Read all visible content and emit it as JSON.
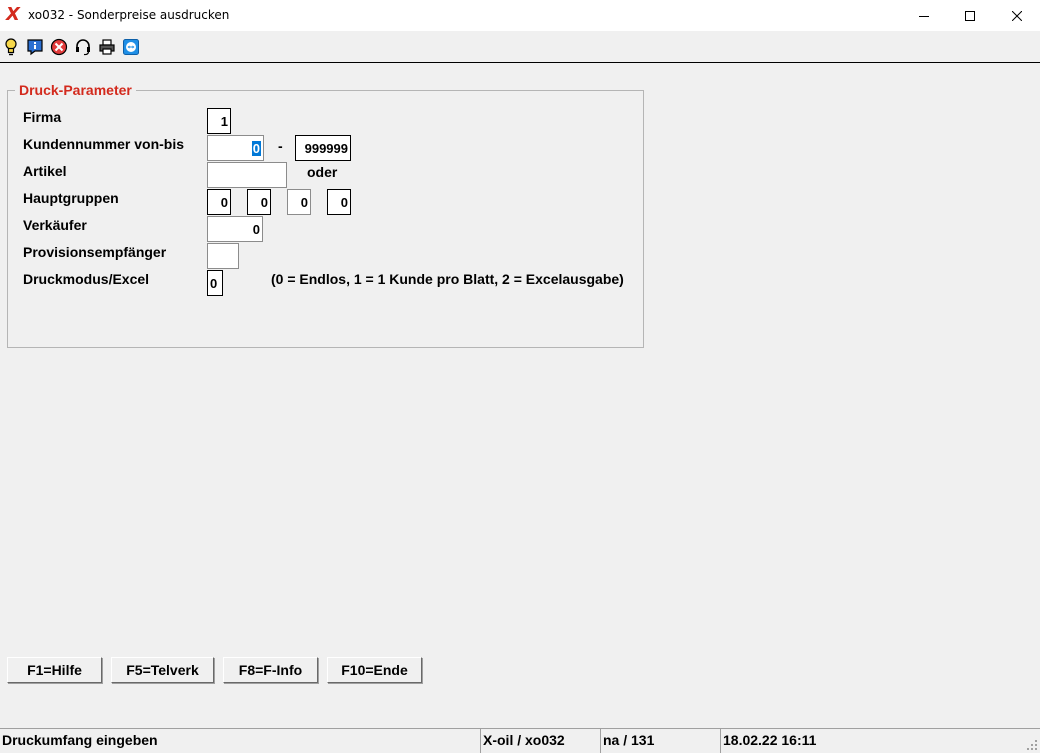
{
  "window": {
    "logo": "X",
    "title": "xo032 - Sonderpreise ausdrucken"
  },
  "toolbar": {
    "icons": [
      "lightbulb-icon",
      "info-icon",
      "stop-icon",
      "headset-icon",
      "printer-icon",
      "teamviewer-icon"
    ]
  },
  "group": {
    "title": "Druck-Parameter"
  },
  "fields": {
    "firma": {
      "label": "Firma",
      "value": "1"
    },
    "kundennummer": {
      "label": "Kundennummer von-bis",
      "from": "0",
      "separator": "-",
      "to": "999999"
    },
    "artikel": {
      "label": "Artikel",
      "value": "",
      "or_label": "oder"
    },
    "hauptgruppen": {
      "label": "Hauptgruppen",
      "values": [
        "0",
        "0",
        "0",
        "0"
      ]
    },
    "verkaeufer": {
      "label": "Verkäufer",
      "value": "0"
    },
    "provision": {
      "label": "Provisionsempfänger",
      "value": ""
    },
    "druckmodus": {
      "label": "Druckmodus/Excel",
      "value": "0",
      "hint": "(0 = Endlos, 1 = 1 Kunde pro Blatt, 2 = Excelausgabe)"
    }
  },
  "fkeys": {
    "f1": "F1=Hilfe",
    "f5": "F5=Telverk",
    "f8": "F8=F-Info",
    "f10": "F10=Ende"
  },
  "status": {
    "message": "Druckumfang eingeben",
    "program": "X-oil / xo032",
    "user": "na / 131",
    "datetime": "18.02.22 16:11"
  },
  "colors": {
    "accent_red": "#d32a1d",
    "selection_blue": "#0078d7"
  }
}
